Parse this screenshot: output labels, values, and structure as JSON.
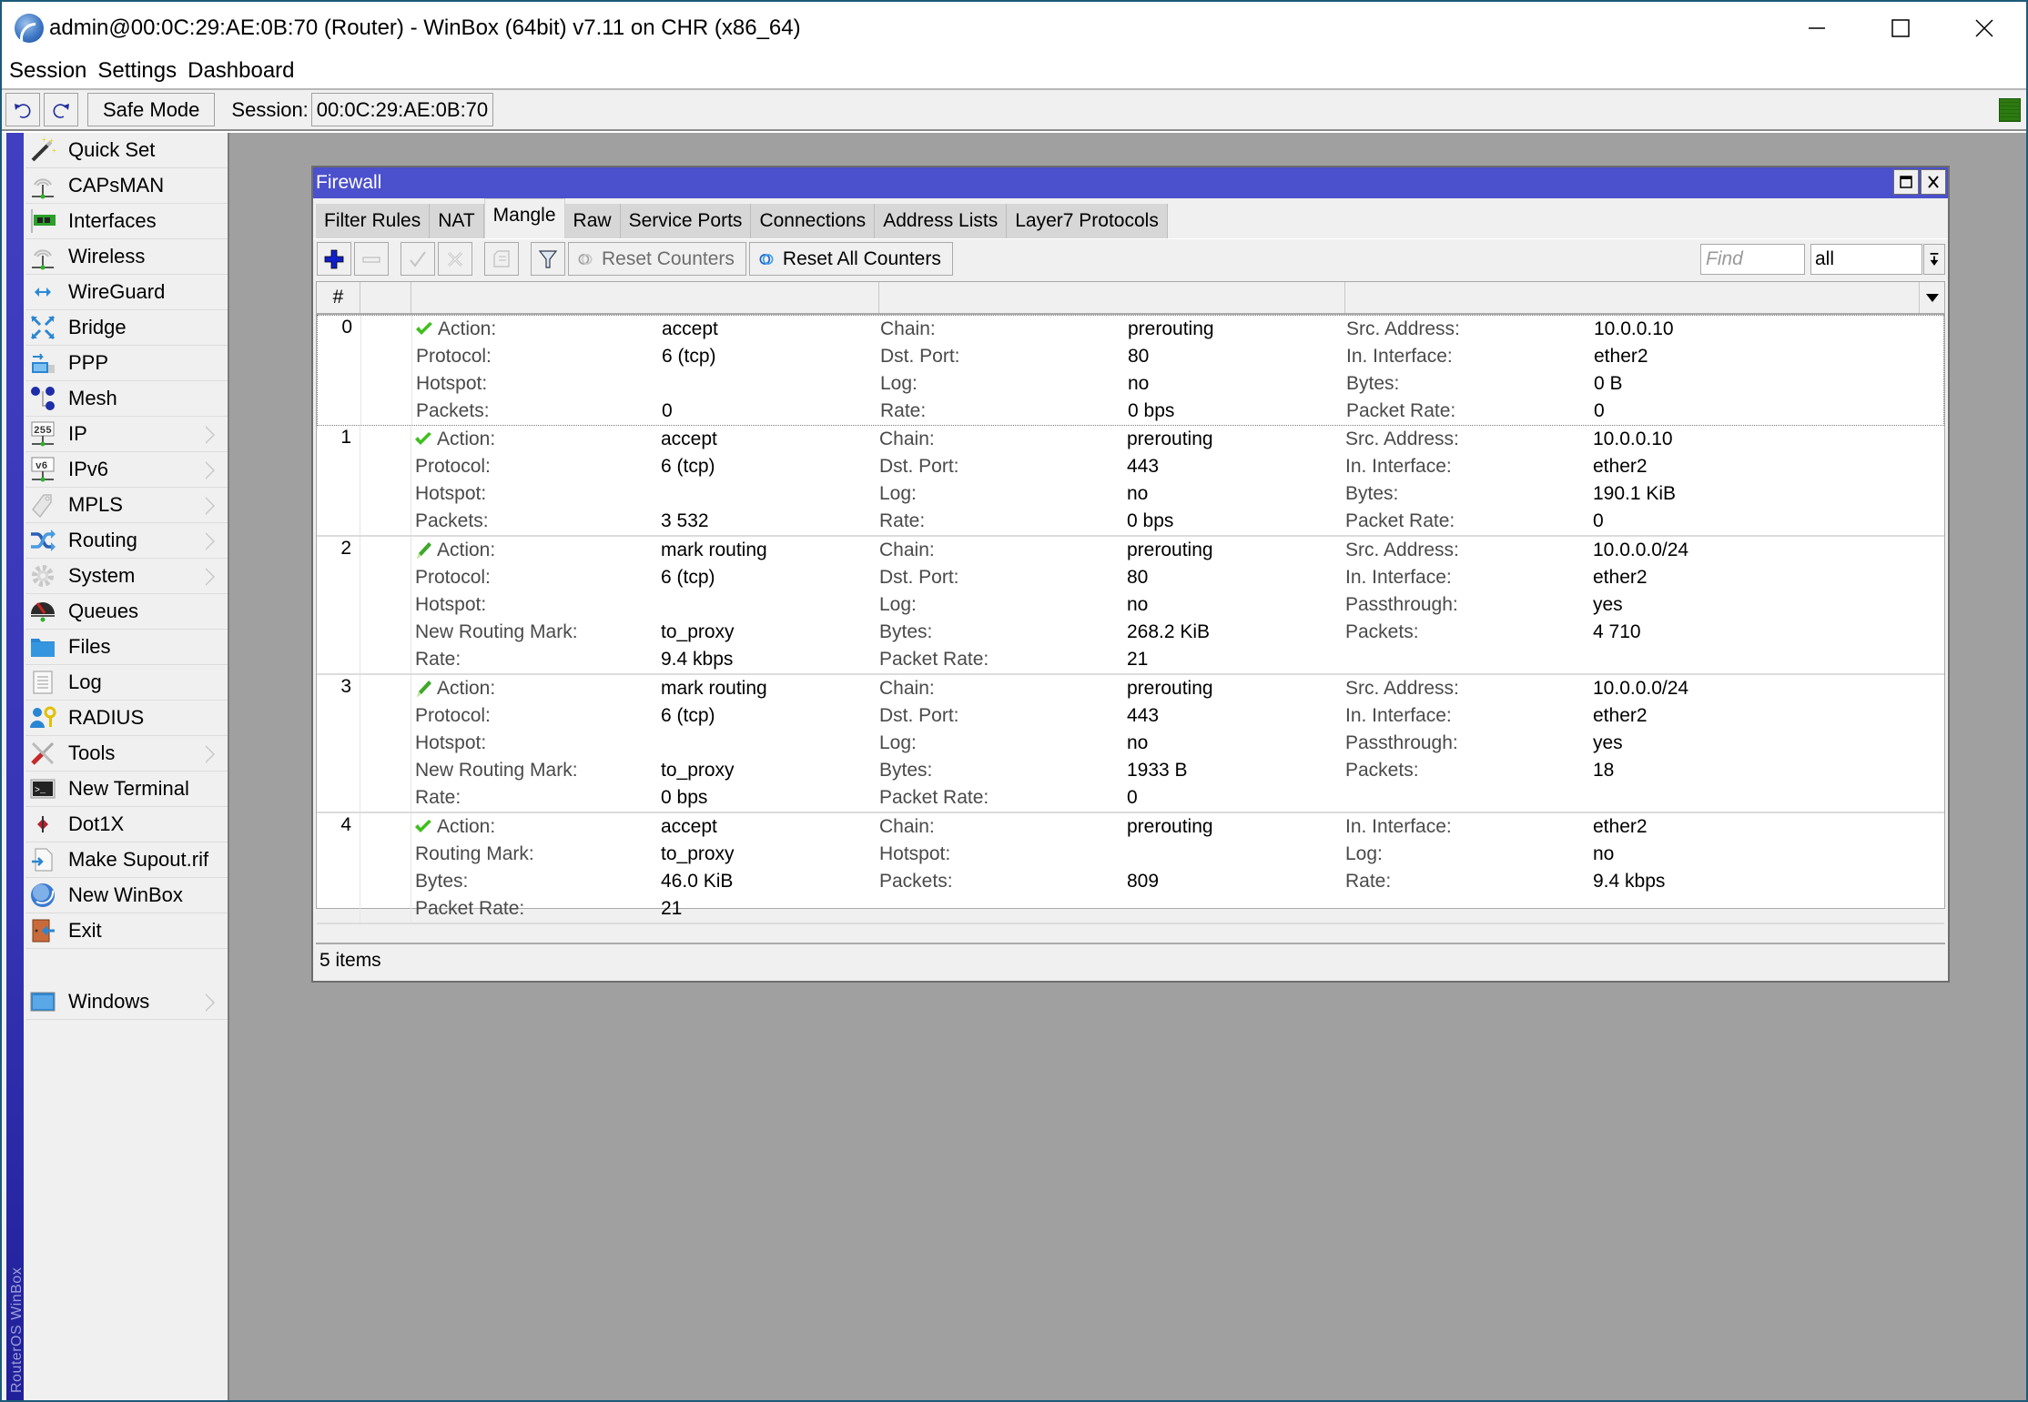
{
  "window": {
    "title": "admin@00:0C:29:AE:0B:70 (Router) - WinBox (64bit) v7.11 on CHR (x86_64)",
    "controls": [
      "minimize",
      "maximize",
      "close"
    ]
  },
  "menubar": [
    "Session",
    "Settings",
    "Dashboard"
  ],
  "toolbar": {
    "undo_icon": "undo-icon",
    "redo_icon": "redo-icon",
    "safe_mode_label": "Safe Mode",
    "session_label": "Session:",
    "session_value": "00:0C:29:AE:0B:70",
    "status_color": "#2e7a12"
  },
  "sidebar": {
    "brand": "RouterOS WinBox",
    "items": [
      {
        "label": "Quick Set",
        "icon": "wand-icon",
        "submenu": false
      },
      {
        "label": "CAPsMAN",
        "icon": "antenna-icon",
        "submenu": false
      },
      {
        "label": "Interfaces",
        "icon": "network-card-icon",
        "submenu": false
      },
      {
        "label": "Wireless",
        "icon": "antenna-icon",
        "submenu": false
      },
      {
        "label": "WireGuard",
        "icon": "wireguard-icon",
        "submenu": false
      },
      {
        "label": "Bridge",
        "icon": "bridge-icon",
        "submenu": false
      },
      {
        "label": "PPP",
        "icon": "ppp-icon",
        "submenu": false
      },
      {
        "label": "Mesh",
        "icon": "mesh-icon",
        "submenu": false
      },
      {
        "label": "IP",
        "icon": "ip-icon",
        "submenu": true
      },
      {
        "label": "IPv6",
        "icon": "ipv6-icon",
        "submenu": true
      },
      {
        "label": "MPLS",
        "icon": "tag-icon",
        "submenu": true
      },
      {
        "label": "Routing",
        "icon": "routing-icon",
        "submenu": true
      },
      {
        "label": "System",
        "icon": "gear-icon",
        "submenu": true
      },
      {
        "label": "Queues",
        "icon": "gauge-icon",
        "submenu": false
      },
      {
        "label": "Files",
        "icon": "folder-icon",
        "submenu": false
      },
      {
        "label": "Log",
        "icon": "log-icon",
        "submenu": false
      },
      {
        "label": "RADIUS",
        "icon": "user-key-icon",
        "submenu": false
      },
      {
        "label": "Tools",
        "icon": "tools-icon",
        "submenu": true
      },
      {
        "label": "New Terminal",
        "icon": "terminal-icon",
        "submenu": false
      },
      {
        "label": "Dot1X",
        "icon": "dot1x-icon",
        "submenu": false
      },
      {
        "label": "Make Supout.rif",
        "icon": "file-arrow-icon",
        "submenu": false
      },
      {
        "label": "New WinBox",
        "icon": "winbox-icon",
        "submenu": false
      },
      {
        "label": "Exit",
        "icon": "exit-door-icon",
        "submenu": false
      }
    ],
    "bottom_items": [
      {
        "label": "Windows",
        "icon": "window-icon",
        "submenu": true
      }
    ]
  },
  "firewall": {
    "title": "Firewall",
    "tabs": [
      {
        "label": "Filter Rules",
        "active": false
      },
      {
        "label": "NAT",
        "active": false
      },
      {
        "label": "Mangle",
        "active": true
      },
      {
        "label": "Raw",
        "active": false
      },
      {
        "label": "Service Ports",
        "active": false
      },
      {
        "label": "Connections",
        "active": false
      },
      {
        "label": "Address Lists",
        "active": false
      },
      {
        "label": "Layer7 Protocols",
        "active": false
      }
    ],
    "toolbar": {
      "reset_counters": "Reset Counters",
      "reset_all_counters": "Reset All Counters",
      "find_placeholder": "Find",
      "filter_value": "all"
    },
    "columns": {
      "num": "#"
    },
    "rules": [
      {
        "num": "0",
        "action_icon": "check-icon",
        "selected": true,
        "lines": [
          [
            "Action:",
            "accept",
            "Chain:",
            "prerouting",
            "Src. Address:",
            "10.0.0.10"
          ],
          [
            "Protocol:",
            "6 (tcp)",
            "Dst. Port:",
            "80",
            "In. Interface:",
            "ether2"
          ],
          [
            "Hotspot:",
            "",
            "Log:",
            "no",
            "Bytes:",
            "0 B"
          ],
          [
            "Packets:",
            "0",
            "Rate:",
            "0 bps",
            "Packet Rate:",
            "0"
          ]
        ]
      },
      {
        "num": "1",
        "action_icon": "check-icon",
        "selected": false,
        "lines": [
          [
            "Action:",
            "accept",
            "Chain:",
            "prerouting",
            "Src. Address:",
            "10.0.0.10"
          ],
          [
            "Protocol:",
            "6 (tcp)",
            "Dst. Port:",
            "443",
            "In. Interface:",
            "ether2"
          ],
          [
            "Hotspot:",
            "",
            "Log:",
            "no",
            "Bytes:",
            "190.1 KiB"
          ],
          [
            "Packets:",
            "3 532",
            "Rate:",
            "0 bps",
            "Packet Rate:",
            "0"
          ]
        ]
      },
      {
        "num": "2",
        "action_icon": "pencil-icon",
        "selected": false,
        "lines": [
          [
            "Action:",
            "mark routing",
            "Chain:",
            "prerouting",
            "Src. Address:",
            "10.0.0.0/24"
          ],
          [
            "Protocol:",
            "6 (tcp)",
            "Dst. Port:",
            "80",
            "In. Interface:",
            "ether2"
          ],
          [
            "Hotspot:",
            "",
            "Log:",
            "no",
            "Passthrough:",
            "yes"
          ],
          [
            "New Routing Mark:",
            "to_proxy",
            "Bytes:",
            "268.2 KiB",
            "Packets:",
            "4 710"
          ],
          [
            "Rate:",
            "9.4 kbps",
            "Packet Rate:",
            "21",
            "",
            ""
          ]
        ]
      },
      {
        "num": "3",
        "action_icon": "pencil-icon",
        "selected": false,
        "lines": [
          [
            "Action:",
            "mark routing",
            "Chain:",
            "prerouting",
            "Src. Address:",
            "10.0.0.0/24"
          ],
          [
            "Protocol:",
            "6 (tcp)",
            "Dst. Port:",
            "443",
            "In. Interface:",
            "ether2"
          ],
          [
            "Hotspot:",
            "",
            "Log:",
            "no",
            "Passthrough:",
            "yes"
          ],
          [
            "New Routing Mark:",
            "to_proxy",
            "Bytes:",
            "1933 B",
            "Packets:",
            "18"
          ],
          [
            "Rate:",
            "0 bps",
            "Packet Rate:",
            "0",
            "",
            ""
          ]
        ]
      },
      {
        "num": "4",
        "action_icon": "check-icon",
        "selected": false,
        "lines": [
          [
            "Action:",
            "accept",
            "Chain:",
            "prerouting",
            "In. Interface:",
            "ether2"
          ],
          [
            "Routing Mark:",
            "to_proxy",
            "Hotspot:",
            "",
            "Log:",
            "no"
          ],
          [
            "Bytes:",
            "46.0 KiB",
            "Packets:",
            "809",
            "Rate:",
            "9.4 kbps"
          ],
          [
            "Packet Rate:",
            "21",
            "",
            "",
            "",
            ""
          ]
        ]
      }
    ],
    "status": "5 items"
  },
  "colors": {
    "window_title_bar": "#4b50cc",
    "sidebar_strip": "#3535b5",
    "workspace": "#a0a0a0",
    "accept_icon": "#3fbf1f",
    "mark_icon": "#3fa82a"
  }
}
